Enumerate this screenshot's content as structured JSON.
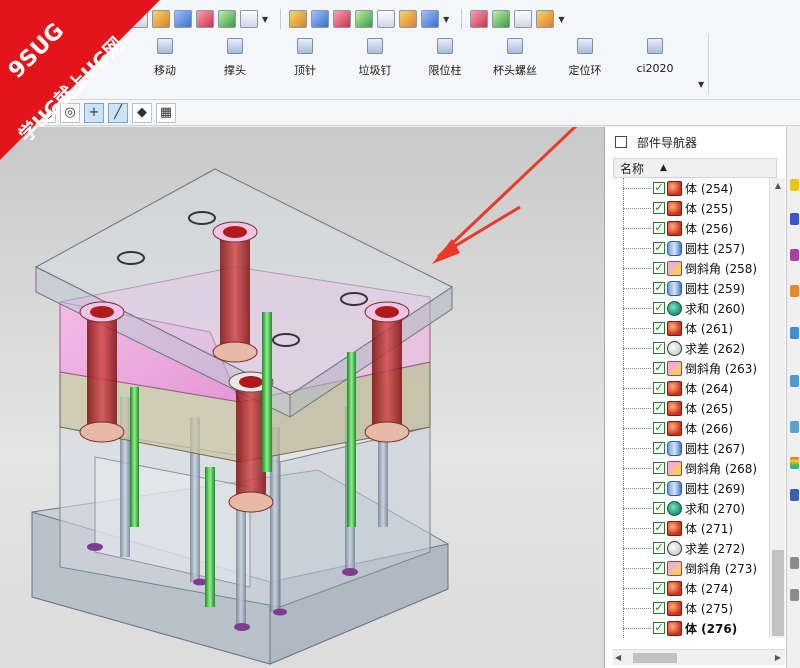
{
  "watermark": {
    "brand": "9SUG",
    "slogan": "学UG就上UG网",
    "color": "#e3151a"
  },
  "toolbar": {
    "icons": [
      "body-icon",
      "block-icon",
      "image-icon",
      "house-icon",
      "cube-icon",
      "cube-alt-icon",
      "sketch-plane-icon",
      "surface-icon",
      "mesh-icon",
      "grid-surface-icon",
      "gears-icon",
      "transform-icon",
      "shape-icon",
      "pin-icon",
      "curve-icon",
      "hook-icon",
      "spline-icon"
    ]
  },
  "commands": [
    {
      "label": "移动",
      "icon": "move-icon"
    },
    {
      "label": "撑头",
      "icon": "support-head-icon"
    },
    {
      "label": "顶针",
      "icon": "ejector-pin-icon"
    },
    {
      "label": "垃圾钉",
      "icon": "stop-pin-icon"
    },
    {
      "label": "限位柱",
      "icon": "limit-post-icon"
    },
    {
      "label": "杯头螺丝",
      "icon": "cap-screw-icon"
    },
    {
      "label": "定位环",
      "icon": "locating-ring-icon"
    },
    {
      "label": "ci2020",
      "icon": "ci2020-icon"
    }
  ],
  "selection_bar": {
    "icons": [
      "circle-icon",
      "target-icon",
      "crosshair-icon",
      "pen-icon",
      "shaded-cube-icon",
      "table-icon"
    ]
  },
  "navigator": {
    "title": "部件导航器",
    "column_name": "名称",
    "rows": [
      {
        "label": "体 (254)",
        "icon": "body"
      },
      {
        "label": "体 (255)",
        "icon": "body"
      },
      {
        "label": "体 (256)",
        "icon": "body"
      },
      {
        "label": "圆柱 (257)",
        "icon": "cyl"
      },
      {
        "label": "倒斜角 (258)",
        "icon": "chamfer"
      },
      {
        "label": "圆柱 (259)",
        "icon": "cyl"
      },
      {
        "label": "求和 (260)",
        "icon": "unite"
      },
      {
        "label": "体 (261)",
        "icon": "body"
      },
      {
        "label": "求差 (262)",
        "icon": "subtract"
      },
      {
        "label": "倒斜角 (263)",
        "icon": "chamfer"
      },
      {
        "label": "体 (264)",
        "icon": "body"
      },
      {
        "label": "体 (265)",
        "icon": "body"
      },
      {
        "label": "体 (266)",
        "icon": "body"
      },
      {
        "label": "圆柱 (267)",
        "icon": "cyl"
      },
      {
        "label": "倒斜角 (268)",
        "icon": "chamfer"
      },
      {
        "label": "圆柱 (269)",
        "icon": "cyl"
      },
      {
        "label": "求和 (270)",
        "icon": "unite"
      },
      {
        "label": "体 (271)",
        "icon": "body"
      },
      {
        "label": "求差 (272)",
        "icon": "subtract"
      },
      {
        "label": "倒斜角 (273)",
        "icon": "chamfer"
      },
      {
        "label": "体 (274)",
        "icon": "body"
      },
      {
        "label": "体 (275)",
        "icon": "body"
      },
      {
        "label": "体 (276)",
        "icon": "body",
        "bold": true
      }
    ]
  },
  "colors": {
    "accent_arrow": "#e8392a",
    "plate_pink": "#f2a6df",
    "pin_green": "#36c33a",
    "bushing_red": "#b32424"
  }
}
